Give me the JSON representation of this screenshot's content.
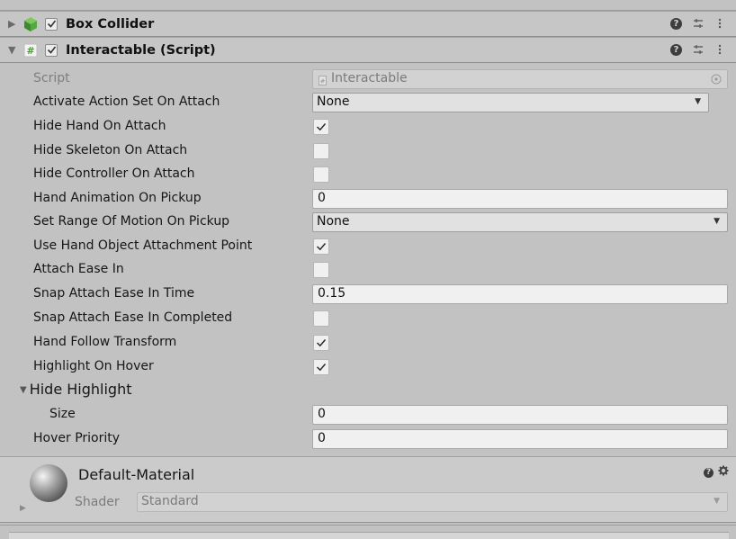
{
  "components": [
    {
      "title": "Box Collider",
      "expanded": false,
      "enabled": true,
      "icon": "cube-icon"
    },
    {
      "title": "Interactable (Script)",
      "expanded": true,
      "enabled": true,
      "icon": "script-icon"
    }
  ],
  "header_icons": {
    "help": "?",
    "preset": "preset-icon",
    "menu": "kebab-icon"
  },
  "properties": {
    "script": {
      "label": "Script",
      "value": "Interactable"
    },
    "activate_action_set": {
      "label": "Activate Action Set On Attach",
      "value": "None"
    },
    "hide_hand": {
      "label": "Hide Hand On Attach",
      "checked": true
    },
    "hide_skeleton": {
      "label": "Hide Skeleton On Attach",
      "checked": false
    },
    "hide_controller": {
      "label": "Hide Controller On Attach",
      "checked": false
    },
    "hand_animation": {
      "label": "Hand Animation On Pickup",
      "value": "0"
    },
    "range_of_motion": {
      "label": "Set Range Of Motion On Pickup",
      "value": "None"
    },
    "use_attachment_point": {
      "label": "Use Hand Object Attachment Point",
      "checked": true
    },
    "attach_ease_in": {
      "label": "Attach Ease In",
      "checked": false
    },
    "snap_ease_time": {
      "label": "Snap Attach Ease In Time",
      "value": "0.15"
    },
    "snap_ease_completed": {
      "label": "Snap Attach Ease In Completed",
      "checked": false
    },
    "hand_follow_transform": {
      "label": "Hand Follow Transform",
      "checked": true
    },
    "highlight_on_hover": {
      "label": "Highlight On Hover",
      "checked": true
    },
    "hide_highlight": {
      "label": "Hide Highlight",
      "expanded": true
    },
    "size": {
      "label": "Size",
      "value": "0"
    },
    "hover_priority": {
      "label": "Hover Priority",
      "value": "0"
    }
  },
  "material": {
    "name": "Default-Material",
    "shader_label": "Shader",
    "shader_value": "Standard"
  },
  "colors": {
    "panel_bg": "#c2c2c2",
    "header_bg": "#c6c6c6",
    "field_bg": "#f0f0f0",
    "cube_green": "#4c9e3a"
  }
}
